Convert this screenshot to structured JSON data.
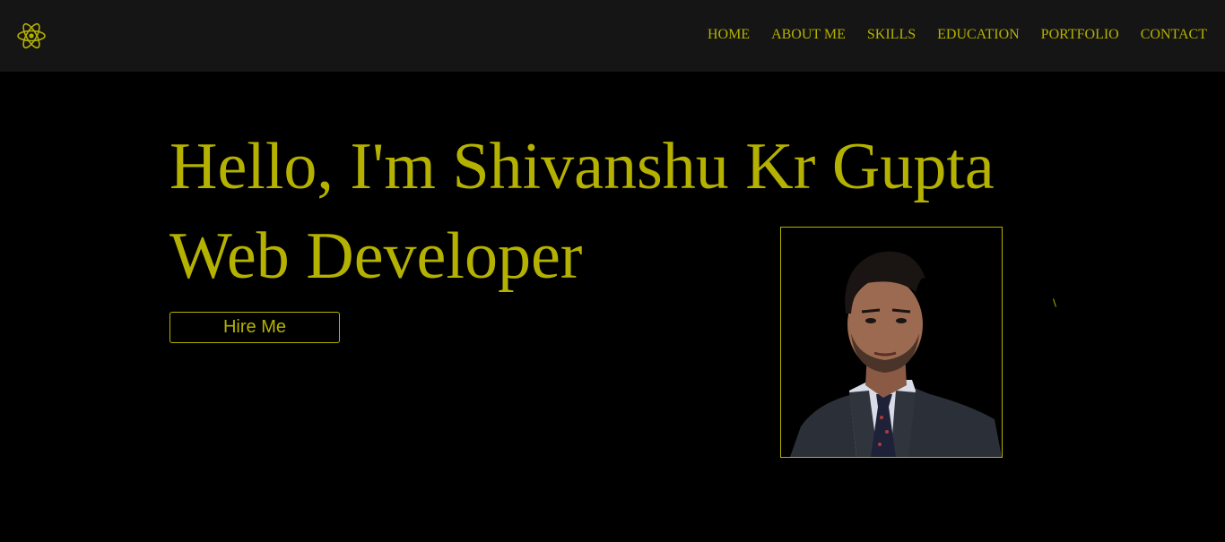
{
  "theme": {
    "accent": "#b5b100",
    "background": "#000000",
    "navbar_background": "#151515"
  },
  "header": {
    "logo_icon": "atom-icon",
    "nav": [
      {
        "label": "HOME"
      },
      {
        "label": "ABOUT ME"
      },
      {
        "label": "SKILLS"
      },
      {
        "label": "EDUCATION"
      },
      {
        "label": "PORTFOLIO"
      },
      {
        "label": "CONTACT"
      }
    ]
  },
  "hero": {
    "title": "Hello, I'm Shivanshu Kr Gupta",
    "subtitle": "Web Developer",
    "cta_label": "Hire Me"
  },
  "profile": {
    "image_icon": "profile-photo"
  }
}
